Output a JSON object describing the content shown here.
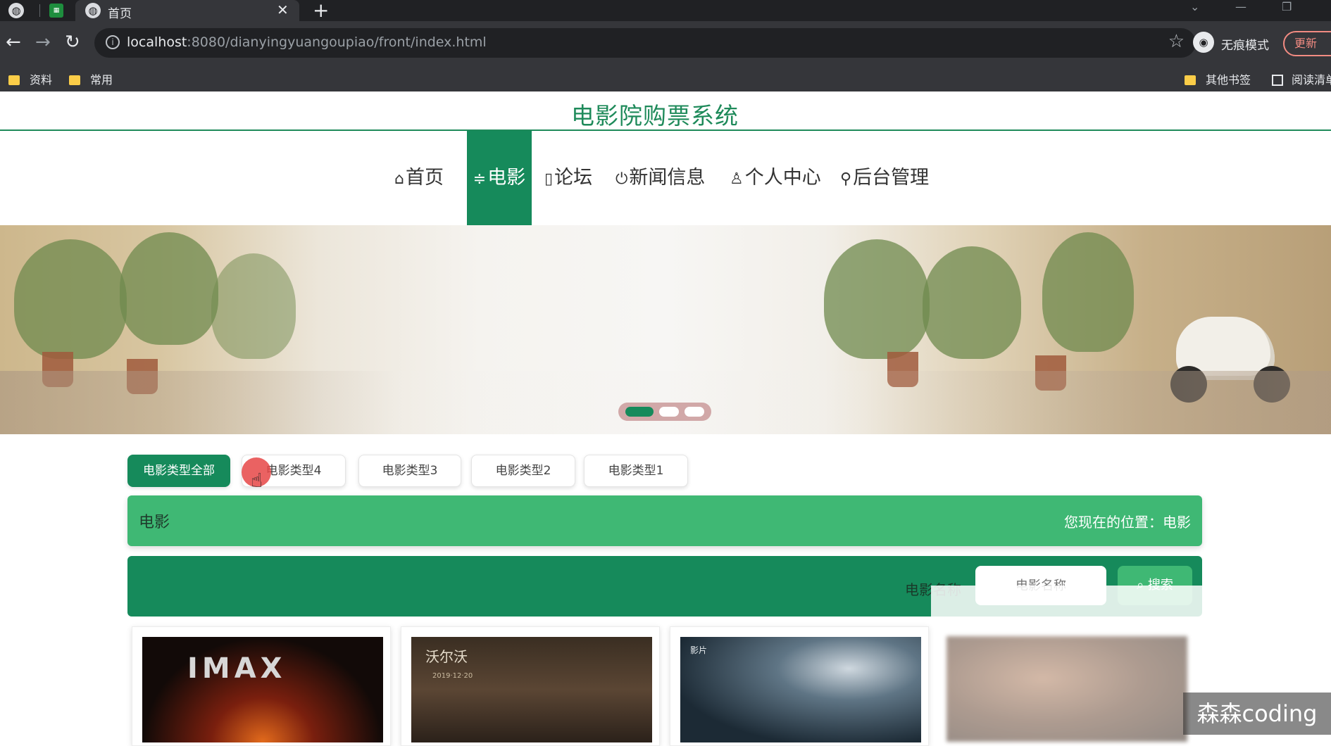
{
  "browser": {
    "tab_title": "首页",
    "url_host": "localhost",
    "url_rest": ":8080/dianyingyuangoupiao/front/index.html",
    "incognito_label": "无痕模式",
    "update_label": "更新",
    "bookmarks": [
      "资料",
      "常用"
    ],
    "bookmarks_right": [
      "其他书签",
      "阅读清单"
    ]
  },
  "site": {
    "title": "电影院购票系统"
  },
  "nav": [
    {
      "icon": "home-icon",
      "label": "首页",
      "active": false
    },
    {
      "icon": "sliders-icon",
      "label": "电影",
      "active": true
    },
    {
      "icon": "forum-icon",
      "label": "论坛",
      "active": false
    },
    {
      "icon": "power-icon",
      "label": "新闻信息",
      "active": false
    },
    {
      "icon": "user-icon",
      "label": "个人中心",
      "active": false
    },
    {
      "icon": "link-icon",
      "label": "后台管理",
      "active": false
    }
  ],
  "banner": {
    "slide_count": 3,
    "active_slide": 1
  },
  "types": [
    {
      "label": "电影类型全部",
      "active": true
    },
    {
      "label": "电影类型4",
      "active": false
    },
    {
      "label": "电影类型3",
      "active": false
    },
    {
      "label": "电影类型2",
      "active": false
    },
    {
      "label": "电影类型1",
      "active": false
    }
  ],
  "section": {
    "title": "电影",
    "position": "您现在的位置：电影"
  },
  "search": {
    "label": "电影名称",
    "placeholder": "电影名称",
    "button": "搜索"
  },
  "posters": [
    {
      "text": "IMAX"
    },
    {
      "text": "沃尔沃",
      "date": "2019·12·20"
    },
    {
      "text": "影片"
    }
  ],
  "watermark": "森森coding",
  "colors": {
    "primary": "#168a5b",
    "light_green": "#3fb874",
    "title_green": "#1e8a5a"
  }
}
